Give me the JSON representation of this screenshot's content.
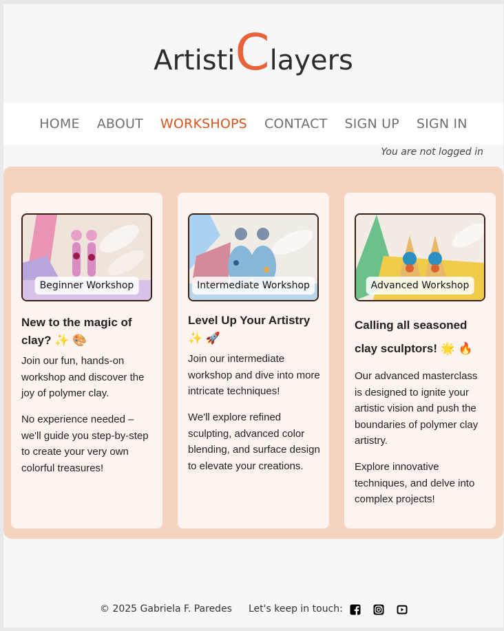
{
  "brand": {
    "logo_prefix": "Artisti",
    "logo_big": "C",
    "logo_suffix": "layers",
    "accent": "#e8633a"
  },
  "nav": {
    "items": [
      "HOME",
      "ABOUT",
      "WORKSHOPS",
      "CONTACT",
      "SIGN UP",
      "SIGN IN"
    ],
    "active": "WORKSHOPS"
  },
  "auth": {
    "status": "You are not logged in"
  },
  "workshops": [
    {
      "badge": "Beginner Workshop",
      "heading": "New to the magic of clay? ✨ 🎨",
      "paragraphs": [
        "Join our fun, hands-on workshop and discover the joy of polymer clay.",
        "No experience needed – we'll guide you step-by-step to create your very own colorful treasures!"
      ]
    },
    {
      "badge": "Intermediate Workshop",
      "heading": "Level Up Your Artistry ✨ 🚀",
      "paragraphs": [
        "Join our intermediate workshop and dive into more intricate techniques!",
        "We'll explore refined sculpting, advanced color blending, and surface design to elevate your creations."
      ]
    },
    {
      "badge": "Advanced Workshop",
      "heading": "Calling all seasoned clay sculptors! 🌟 🔥",
      "paragraphs": [
        "Our advanced masterclass is designed to ignite your artistic vision and push the boundaries of polymer clay artistry.",
        "Explore innovative techniques, and delve into complex projects!"
      ]
    }
  ],
  "footer": {
    "copyright": "© 2025 Gabriela F. Paredes",
    "touch_label": "Let's keep in touch:",
    "social_icons": [
      "facebook-icon",
      "instagram-icon",
      "youtube-icon"
    ]
  }
}
